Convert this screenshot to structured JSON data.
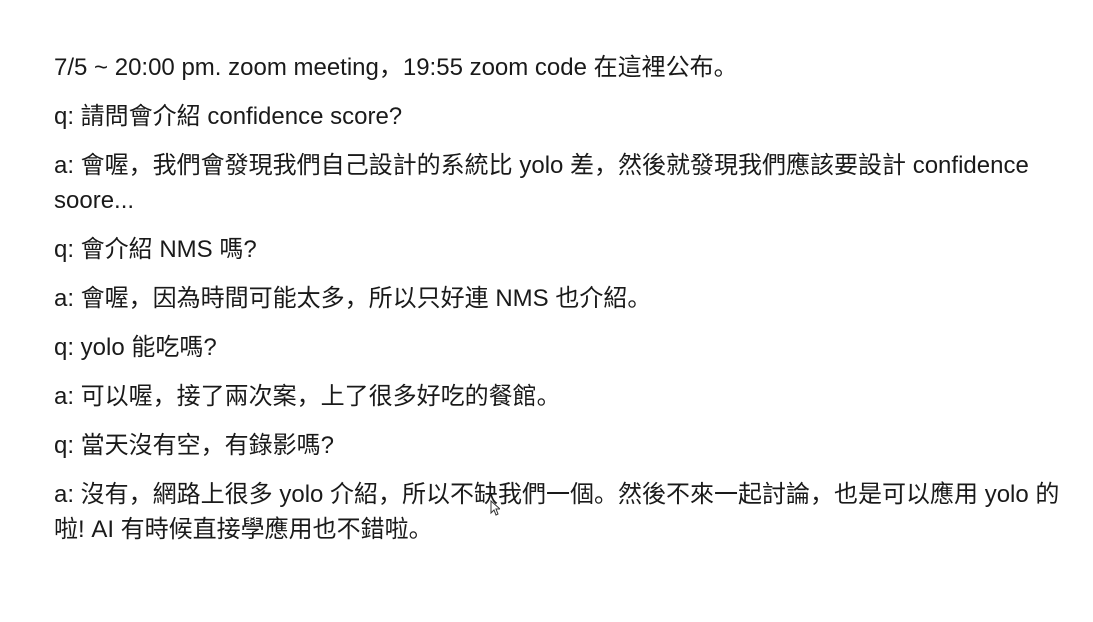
{
  "document": {
    "paragraphs": [
      "7/5 ~ 20:00 pm.  zoom meeting，19:55 zoom code 在這裡公布。",
      "q: 請問會介紹 confidence score?",
      "a: 會喔，我們會發現我們自己設計的系統比 yolo 差，然後就發現我們應該要設計 confidence soore...",
      "q: 會介紹 NMS 嗎?",
      "a: 會喔，因為時間可能太多，所以只好連 NMS 也介紹。",
      "q: yolo 能吃嗎?",
      "a: 可以喔，接了兩次案，上了很多好吃的餐館。",
      "q: 當天沒有空，有錄影嗎?",
      "a: 沒有，網路上很多 yolo 介紹，所以不缺我們一個。然後不來一起討論，也是可以應用 yolo 的啦!  AI 有時候直接學應用也不錯啦。"
    ]
  }
}
